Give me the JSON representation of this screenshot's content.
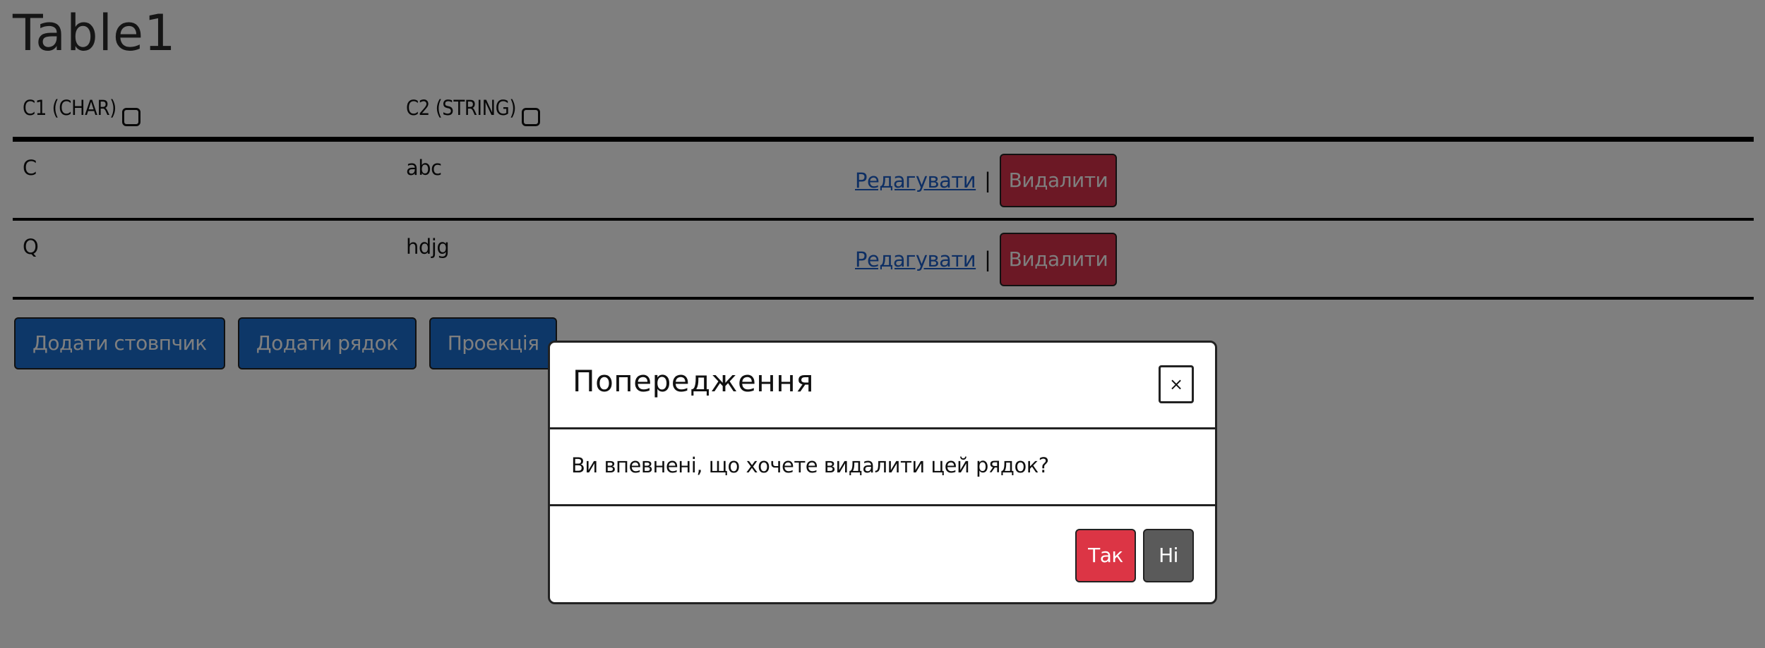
{
  "page": {
    "title": "Table1"
  },
  "table": {
    "columns": [
      {
        "label": "C1 (CHAR)"
      },
      {
        "label": "C2 (STRING)"
      }
    ],
    "rows": [
      {
        "c1": "C",
        "c2": "abc",
        "edit_label": "Редагувати",
        "separator": "|",
        "delete_label": "Видалити"
      },
      {
        "c1": "Q",
        "c2": "hdjg",
        "edit_label": "Редагувати",
        "separator": "|",
        "delete_label": "Видалити"
      }
    ]
  },
  "actions": {
    "add_column": "Додати стовпчик",
    "add_row": "Додати рядок",
    "projection": "Проекція"
  },
  "modal": {
    "title": "Попередження",
    "close": "×",
    "message": "Ви впевнені, що хочете видалити цей рядок?",
    "yes": "Так",
    "no": "Ні"
  },
  "colors": {
    "primary": "#1b6fd1",
    "danger": "#dc3545",
    "secondary": "#5a5a5a",
    "link": "#1c5fc9"
  }
}
